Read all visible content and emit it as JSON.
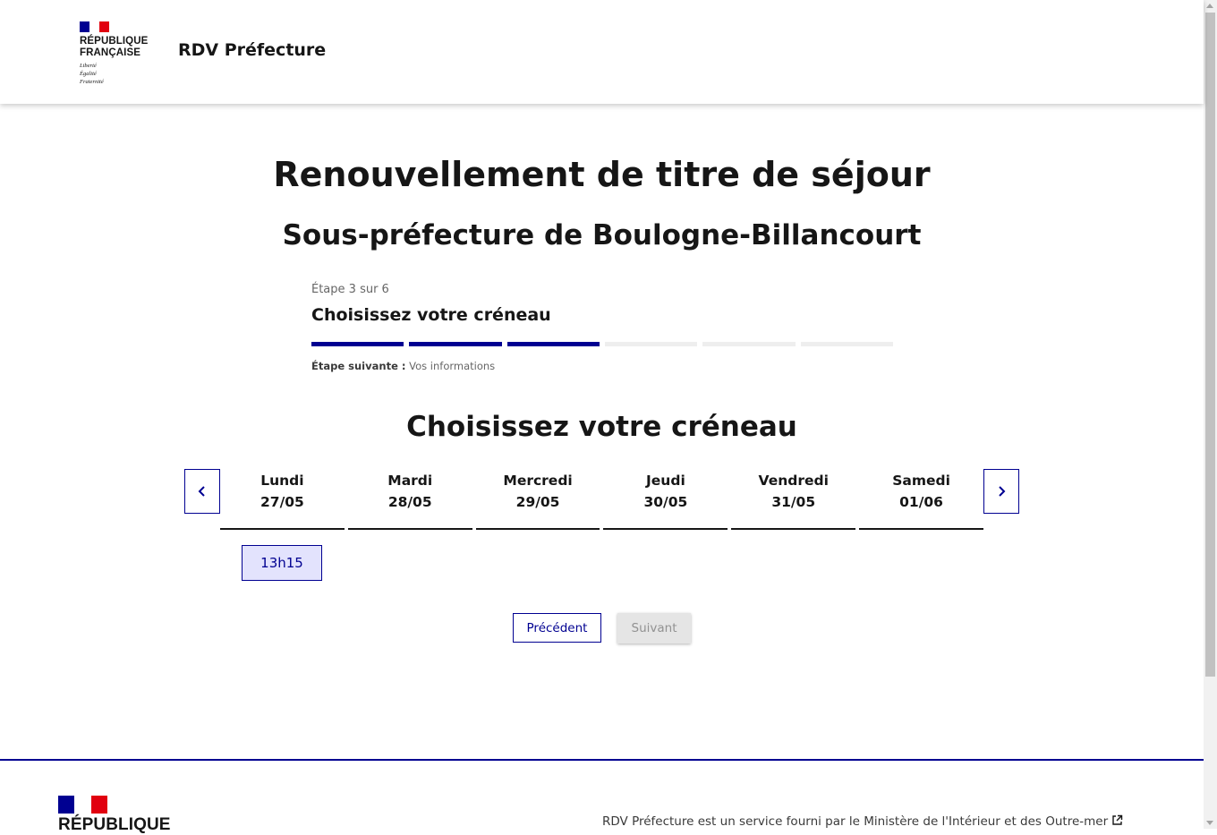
{
  "header": {
    "logo": {
      "line1": "RÉPUBLIQUE",
      "line2": "FRANÇAISE",
      "motto": [
        "Liberté",
        "Égalité",
        "Fraternité"
      ]
    },
    "service_title": "RDV Préfecture"
  },
  "main": {
    "title": "Renouvellement de titre de séjour",
    "subtitle": "Sous-préfecture de Boulogne-Billancourt",
    "stepper": {
      "state": "Étape 3 sur 6",
      "title": "Choisissez votre créneau",
      "current_step": 3,
      "total_steps": 6,
      "next_label": "Étape suivante :",
      "next_value": "Vos informations"
    },
    "section_title": "Choisissez votre créneau",
    "days": [
      {
        "name": "Lundi",
        "date": "27/05"
      },
      {
        "name": "Mardi",
        "date": "28/05"
      },
      {
        "name": "Mercredi",
        "date": "29/05"
      },
      {
        "name": "Jeudi",
        "date": "30/05"
      },
      {
        "name": "Vendredi",
        "date": "31/05"
      },
      {
        "name": "Samedi",
        "date": "01/06"
      }
    ],
    "slots": [
      "13h15"
    ],
    "buttons": {
      "previous": "Précédent",
      "next": "Suivant"
    }
  },
  "footer": {
    "logo_line1": "RÉPUBLIQUE",
    "description": "RDV Préfecture est un service fourni par le Ministère de l'Intérieur et des Outre-mer"
  },
  "icons": {
    "prev": "chevron-left-icon",
    "next": "chevron-right-icon",
    "external": "external-link-icon",
    "marianne": "marianne-icon"
  },
  "colors": {
    "primary": "#000091",
    "flag_blue": "#000091",
    "flag_red": "#e1000f",
    "slot_bg": "#e3e3fd",
    "step_inactive": "#eeeeee"
  }
}
